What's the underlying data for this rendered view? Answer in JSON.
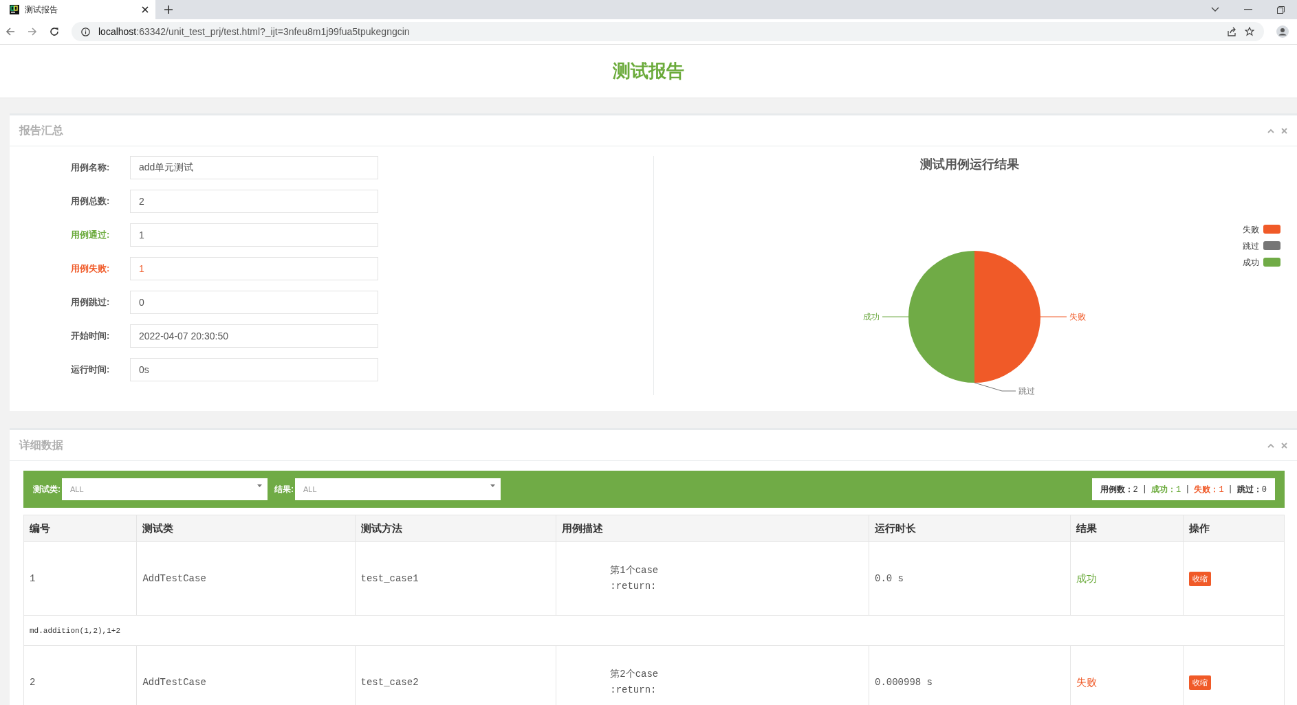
{
  "browser": {
    "tab_title": "测试报告",
    "url_host": "localhost",
    "url_path": ":63342/unit_test_prj/test.html?_ijt=3nfeu8m1j99fua5tpukegngcin"
  },
  "page_title": "测试报告",
  "summary": {
    "title": "报告汇总",
    "fields": [
      {
        "label": "用例名称:",
        "value": "add单元测试",
        "kind": "plain"
      },
      {
        "label": "用例总数:",
        "value": "2",
        "kind": "plain"
      },
      {
        "label": "用例通过:",
        "value": "1",
        "kind": "passed"
      },
      {
        "label": "用例失败:",
        "value": "1",
        "kind": "failed"
      },
      {
        "label": "用例跳过:",
        "value": "0",
        "kind": "plain"
      },
      {
        "label": "开始时间:",
        "value": "2022-04-07 20:30:50",
        "kind": "plain"
      },
      {
        "label": "运行时间:",
        "value": "0s",
        "kind": "plain"
      }
    ],
    "chart_data": {
      "type": "pie",
      "title": "测试用例运行结果",
      "categories": [
        "失败",
        "跳过",
        "成功"
      ],
      "series": [
        {
          "values": [
            50,
            0,
            50
          ]
        }
      ],
      "colors": [
        "#f05a28",
        "#767676",
        "#70ab46"
      ],
      "legend": true
    },
    "legend": [
      {
        "label": "失败",
        "color": "#f05a28"
      },
      {
        "label": "跳过",
        "color": "#767676"
      },
      {
        "label": "成功",
        "color": "#70ab46"
      }
    ]
  },
  "details": {
    "title": "详细数据",
    "filters": [
      {
        "label": "测试类:",
        "value": "ALL"
      },
      {
        "label": "结果:",
        "value": "ALL"
      }
    ],
    "stats": [
      {
        "label": "用例数：",
        "value": "2",
        "kind": "plain"
      },
      {
        "label": "成功：",
        "value": "1",
        "kind": "passed"
      },
      {
        "label": "失败：",
        "value": "1",
        "kind": "failed"
      },
      {
        "label": "跳过：",
        "value": "0",
        "kind": "plain"
      }
    ],
    "stat_separator": "|",
    "columns": [
      "编号",
      "测试类",
      "测试方法",
      "用例描述",
      "运行时长",
      "结果",
      "操作"
    ],
    "rows": [
      {
        "kind": "case",
        "id": "1",
        "class": "AddTestCase",
        "method": "test_case1",
        "description": [
          "第1个case",
          ":return:"
        ],
        "duration": "0.0 s",
        "result": "成功",
        "passed": true,
        "action": "收缩"
      },
      {
        "kind": "detail",
        "text": "md.addition(1,2),1+2"
      },
      {
        "kind": "case",
        "id": "2",
        "class": "AddTestCase",
        "method": "test_case2",
        "description": [
          "第2个case",
          ":return:"
        ],
        "duration": "0.000998 s",
        "result": "失败",
        "passed": false,
        "action": "收缩"
      }
    ]
  }
}
